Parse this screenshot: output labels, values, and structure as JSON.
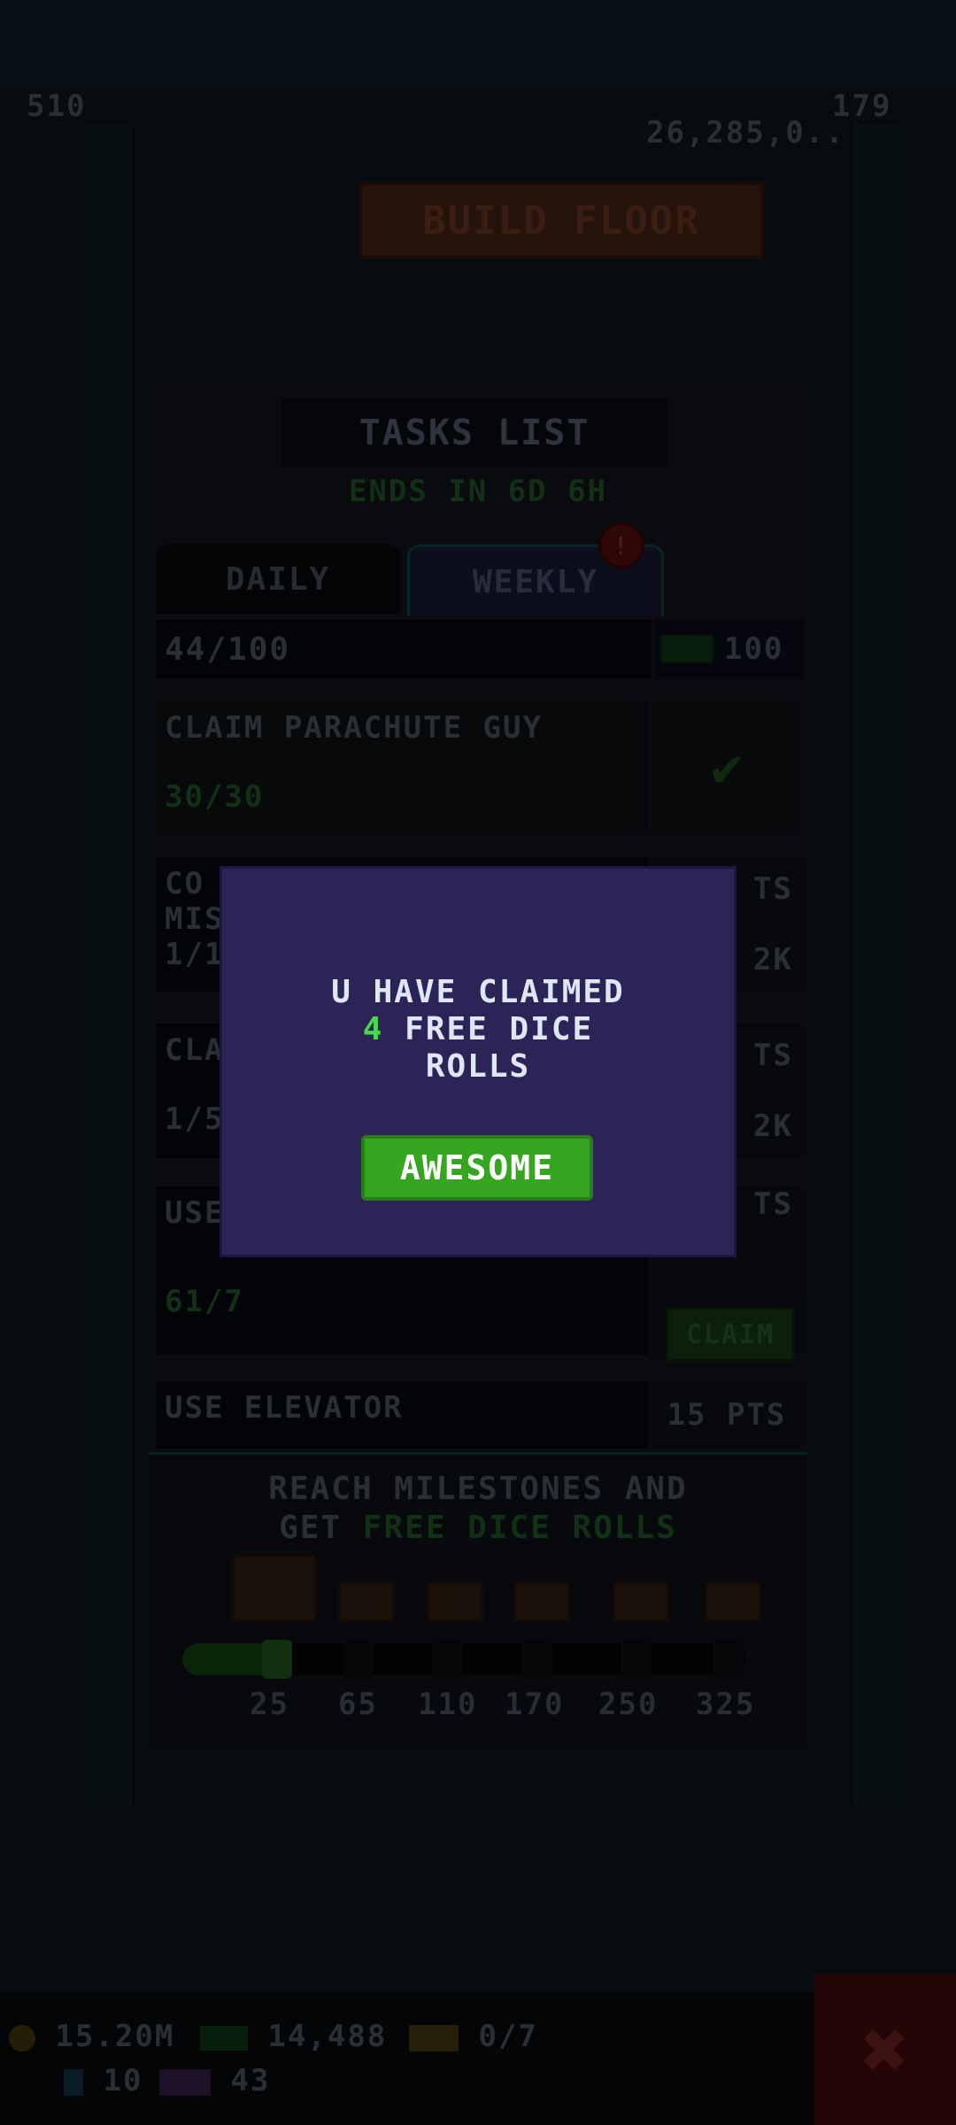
{
  "top_bar": {
    "left_stat": "510",
    "right_stat": "179",
    "money": "26,285,0..",
    "build_floor_label": "BUILD FLOOR"
  },
  "tasks_panel": {
    "title": "TASKS LIST",
    "ends_in": "ENDS IN 6D 6H",
    "tabs": [
      {
        "label": "DAILY"
      },
      {
        "label": "WEEKLY"
      }
    ],
    "weekly_badge": "!",
    "progress": "44/100",
    "progress_reward": "100",
    "tasks": [
      {
        "name": "CLAIM PARACHUTE GUY",
        "progress": "30/30"
      },
      {
        "name": "CO",
        "name2": "MIS",
        "progress": "1/1",
        "pts": "TS",
        "reward": "2K"
      },
      {
        "name": "CLA",
        "progress": "1/5",
        "pts": "TS",
        "reward": "2K"
      },
      {
        "name": "USE",
        "progress": "61/7",
        "pts": "TS",
        "claim_label": "CLAIM"
      },
      {
        "name": "USE ELEVATOR",
        "pts": "15 PTS"
      }
    ],
    "milestones": {
      "text_line1": "REACH MILESTONES AND",
      "text_line2_prefix": "GET",
      "text_line2_highlight": "FREE DICE ROLLS",
      "points": [
        "25",
        "65",
        "110",
        "170",
        "250",
        "325"
      ],
      "progress_fraction": 0.1
    }
  },
  "bottom_hud": {
    "coins": "15.20M",
    "bux": "14,488",
    "tickets": "0/7",
    "gems": "10",
    "vip": "43"
  },
  "modal": {
    "line1": "U HAVE CLAIMED",
    "number": "4",
    "line2": "FREE DICE",
    "line3": "ROLLS",
    "button_label": "AWESOME"
  },
  "colors": {
    "modal_bg": "#2c2457",
    "button_green": "#36a51f",
    "highlight_green": "#46d74a"
  }
}
